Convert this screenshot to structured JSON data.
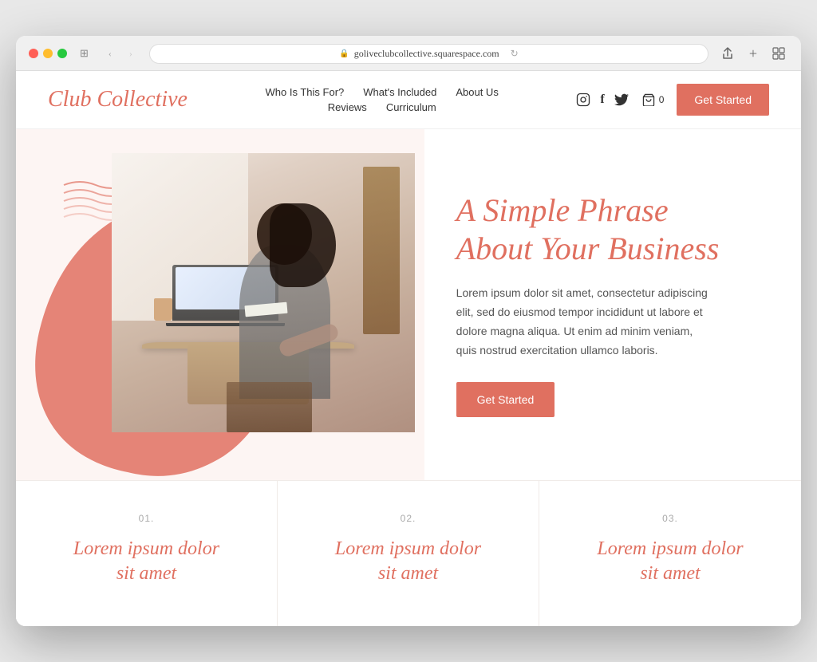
{
  "browser": {
    "url": "goliveclubcollective.squarespace.com",
    "refresh_icon": "↻"
  },
  "header": {
    "logo": "Club Collective",
    "nav": {
      "row1": [
        {
          "label": "Who Is This For?",
          "id": "who-is-this-for"
        },
        {
          "label": "What's Included",
          "id": "whats-included"
        },
        {
          "label": "About Us",
          "id": "about-us"
        }
      ],
      "row2": [
        {
          "label": "Reviews",
          "id": "reviews"
        },
        {
          "label": "Curriculum",
          "id": "curriculum"
        }
      ]
    },
    "cart_label": "0",
    "cta_label": "Get Started"
  },
  "hero": {
    "heading_line1": "A Simple Phrase",
    "heading_line2": "About Your Business",
    "body_text": "Lorem ipsum dolor sit amet, consectetur adipiscing elit, sed do eiusmod tempor incididunt ut labore et dolore magna aliqua. Ut enim ad minim veniam, quis nostrud exercitation ullamco laboris.",
    "cta_label": "Get Started"
  },
  "features": [
    {
      "number": "01.",
      "title_line1": "Lorem ipsum dolor",
      "title_line2": "sit amet"
    },
    {
      "number": "02.",
      "title_line1": "Lorem ipsum dolor",
      "title_line2": "sit amet"
    },
    {
      "number": "03.",
      "title_line1": "Lorem ipsum dolor",
      "title_line2": "sit amet"
    }
  ],
  "colors": {
    "brand_coral": "#e07060",
    "bg_light": "#fdf5f3"
  },
  "icons": {
    "instagram": "📷",
    "facebook": "f",
    "twitter": "🐦",
    "cart": "🛒",
    "lock": "🔒"
  }
}
